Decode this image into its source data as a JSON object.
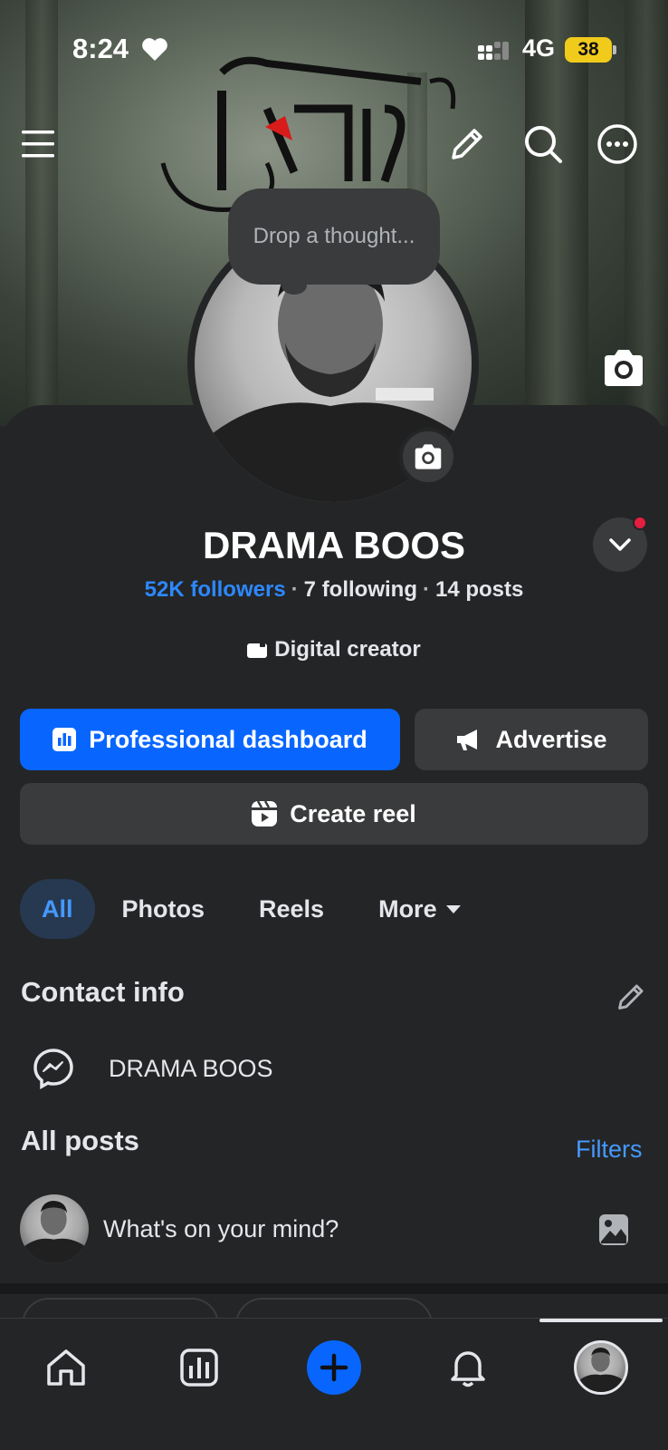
{
  "status_bar": {
    "time": "8:24",
    "network": "4G",
    "battery": "38"
  },
  "cover": {
    "title_glyphs": "প্রিয়"
  },
  "thought_bubble": {
    "placeholder": "Drop a thought..."
  },
  "profile": {
    "name": "DRAMA BOOS",
    "followers": "52K followers",
    "following": "7 following",
    "posts": "14 posts",
    "category": "Digital creator"
  },
  "actions": {
    "dashboard_label": "Professional dashboard",
    "advertise_label": "Advertise",
    "create_reel_label": "Create reel"
  },
  "tabs": [
    {
      "label": "All",
      "active": true
    },
    {
      "label": "Photos",
      "active": false
    },
    {
      "label": "Reels",
      "active": false
    },
    {
      "label": "More",
      "active": false
    }
  ],
  "contact_info": {
    "title": "Contact info",
    "messenger": "DRAMA BOOS"
  },
  "posts_section": {
    "title": "All posts",
    "filters_label": "Filters",
    "composer_prompt": "What's on your mind?"
  },
  "colors": {
    "accent": "#0866ff",
    "link": "#2d88ff",
    "background": "#242526",
    "surface": "#3a3b3c",
    "battery": "#f1cb1c",
    "notification_dot": "#e41e3f"
  },
  "icons": {
    "top": [
      "menu-icon",
      "pencil-icon",
      "search-icon",
      "more-icon"
    ],
    "bottom_nav": [
      "home-icon",
      "dashboard-icon",
      "create-icon",
      "bell-icon",
      "profile-icon"
    ]
  }
}
